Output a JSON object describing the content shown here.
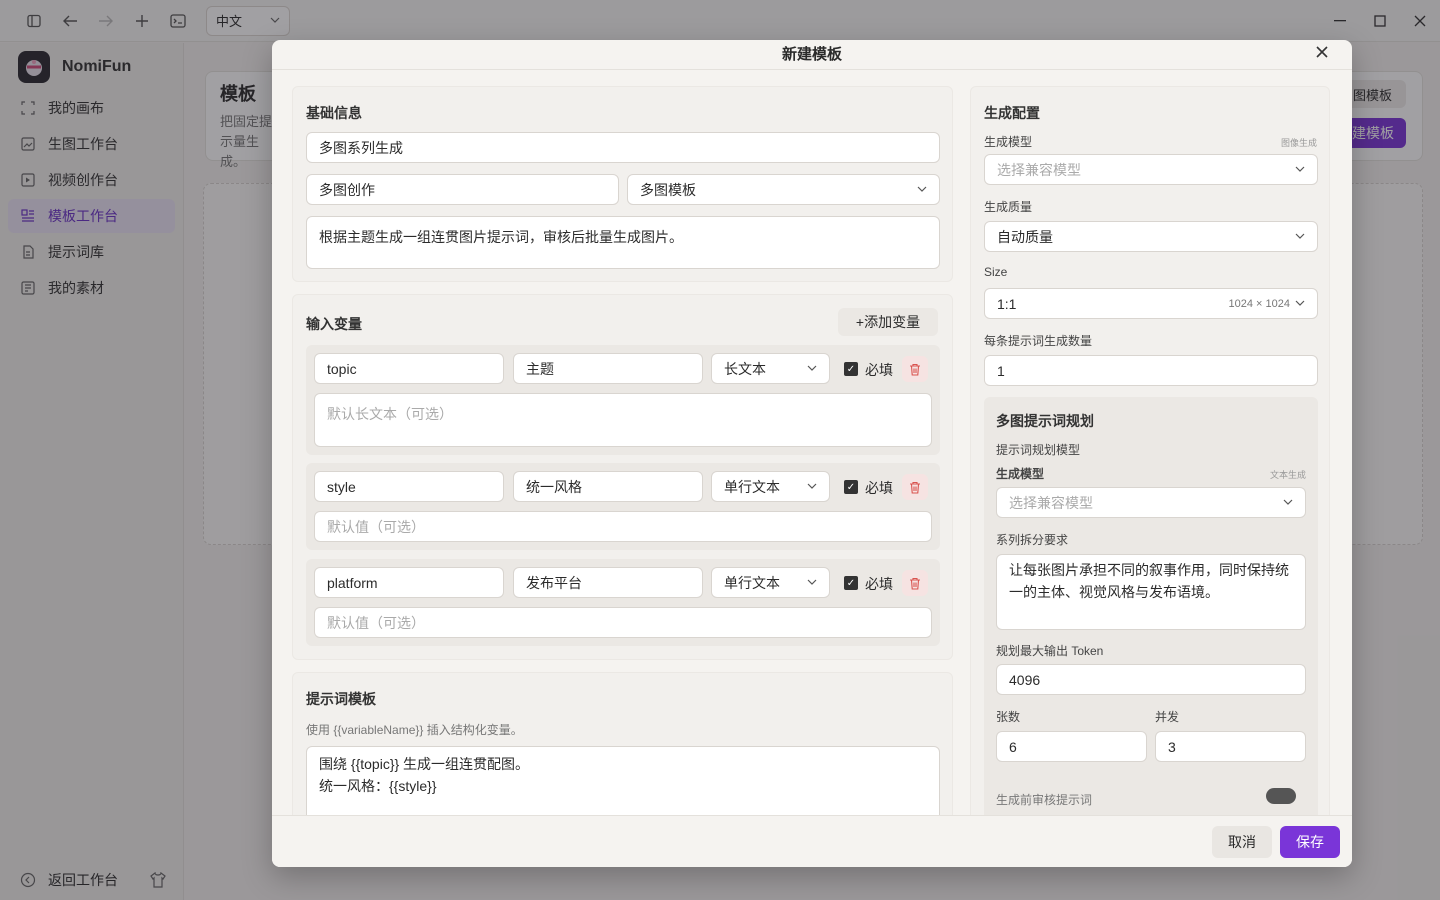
{
  "titlebar": {
    "language": "中文"
  },
  "sidebar": {
    "app_name": "NomiFun",
    "items": [
      {
        "label": "我的画布",
        "icon": "canvas-icon"
      },
      {
        "label": "生图工作台",
        "icon": "image-gen-icon"
      },
      {
        "label": "视频创作台",
        "icon": "video-icon"
      },
      {
        "label": "模板工作台",
        "icon": "template-icon",
        "active": true
      },
      {
        "label": "提示词库",
        "icon": "prompt-library-icon"
      },
      {
        "label": "我的素材",
        "icon": "assets-icon"
      }
    ],
    "footer_label": "返回工作台"
  },
  "background": {
    "title": "模板",
    "desc": "把固定提示量生成。",
    "btn_secondary": "图模板",
    "btn_primary": "建模板"
  },
  "modal": {
    "title": "新建模板",
    "basic": {
      "title": "基础信息",
      "name": "多图系列生成",
      "category": "多图创作",
      "type": "多图模板",
      "description": "根据主题生成一组连贯图片提示词，审核后批量生成图片。"
    },
    "variables": {
      "title": "输入变量",
      "add_label": "+添加变量",
      "required_label": "必填",
      "items": [
        {
          "key": "topic",
          "name": "主题",
          "type": "长文本",
          "placeholder": "默认长文本（可选）"
        },
        {
          "key": "style",
          "name": "统一风格",
          "type": "单行文本",
          "placeholder": "默认值（可选）"
        },
        {
          "key": "platform",
          "name": "发布平台",
          "type": "单行文本",
          "placeholder": "默认值（可选）"
        }
      ]
    },
    "prompt": {
      "title": "提示词模板",
      "hint": "使用 {{variableName}} 插入结构化变量。",
      "line1": "围绕 {{topic}} 生成一组连贯配图。",
      "line2": "统一风格：{{style}}"
    },
    "config": {
      "title": "生成配置",
      "model_label": "生成模型",
      "model_tag": "图像生成",
      "model_placeholder": "选择兼容模型",
      "quality_label": "生成质量",
      "quality_value": "自动质量",
      "size_label": "Size",
      "size_value": "1:1",
      "size_detail": "1024 × 1024",
      "count_label": "每条提示词生成数量",
      "count_value": "1"
    },
    "planning": {
      "title": "多图提示词规划",
      "planner_label": "提示词规划模型",
      "model_label": "生成模型",
      "model_tag": "文本生成",
      "model_placeholder": "选择兼容模型",
      "split_label": "系列拆分要求",
      "split_value": "让每张图片承担不同的叙事作用，同时保持统一的主体、视觉风格与发布语境。",
      "token_label": "规划最大输出 Token",
      "token_value": "4096",
      "count_label": "张数",
      "count_value": "6",
      "concurrency_label": "并发",
      "concurrency_value": "3",
      "review_label": "生成前审核提示词"
    },
    "footer": {
      "cancel": "取消",
      "save": "保存"
    }
  }
}
